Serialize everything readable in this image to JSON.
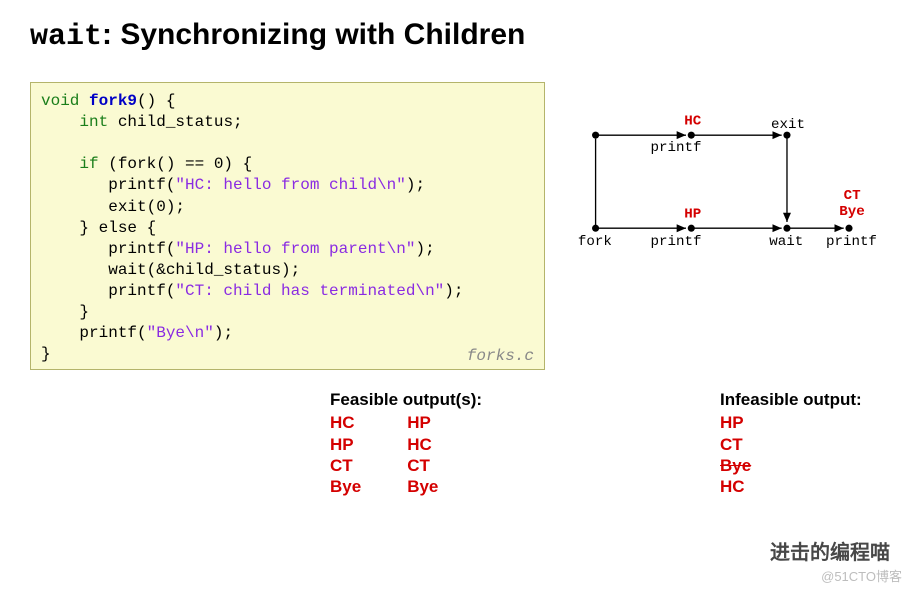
{
  "title_code": "wait",
  "title_rest": ": Synchronizing with Children",
  "code": {
    "l1a": "void",
    "l1b": "fork9",
    "l1c": "() {",
    "l2a": "    int",
    "l2b": " child_status;",
    "l3": "",
    "l4a": "    if",
    "l4b": " (fork() == 0) {",
    "l5a": "       printf(",
    "l5b": "\"HC: hello from child\\n\"",
    "l5c": ");",
    "l6": "       exit(0);",
    "l7": "    } else {",
    "l8a": "       printf(",
    "l8b": "\"HP: hello from parent\\n\"",
    "l8c": ");",
    "l9": "       wait(&child_status);",
    "l10a": "       printf(",
    "l10b": "\"CT: child has terminated\\n\"",
    "l10c": ");",
    "l11": "    }",
    "l12a": "    printf(",
    "l12b": "\"Bye\\n\"",
    "l12c": ");",
    "l13": "}",
    "file": "forks.c"
  },
  "diagram": {
    "fork": "fork",
    "printf": "printf",
    "wait": "wait",
    "exit": "exit",
    "HC": "HC",
    "HP": "HP",
    "CT": "CT",
    "Bye": "Bye"
  },
  "feasible": {
    "heading": "Feasible output(s):",
    "col1": [
      "HC",
      "HP",
      "CT",
      "Bye"
    ],
    "col2": [
      "HP",
      "HC",
      "CT",
      "Bye"
    ]
  },
  "infeasible": {
    "heading": "Infeasible output:",
    "items": [
      "HP",
      "CT",
      "Bye",
      "HC"
    ]
  },
  "watermark1": "进击的编程喵",
  "watermark2": "@51CTO博客"
}
